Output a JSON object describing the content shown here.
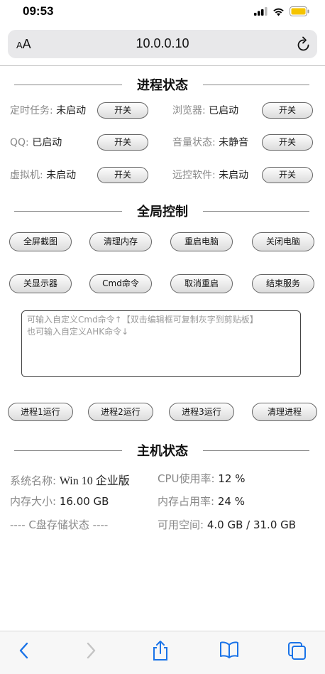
{
  "status_bar": {
    "time": "09:53"
  },
  "browser": {
    "text_size_label": "AA",
    "url": "10.0.0.10"
  },
  "process_status": {
    "title": "进程状态",
    "items": [
      {
        "label": "定时任务:",
        "value": "未启动",
        "button": "开关"
      },
      {
        "label": "浏览器:",
        "value": "已启动",
        "button": "开关"
      },
      {
        "label": "QQ:",
        "value": "已启动",
        "button": "开关"
      },
      {
        "label": "音量状态:",
        "value": "未静音",
        "button": "开关"
      },
      {
        "label": "虚拟机:",
        "value": "未启动",
        "button": "开关"
      },
      {
        "label": "远控软件:",
        "value": "未启动",
        "button": "开关"
      }
    ]
  },
  "global_control": {
    "title": "全局控制",
    "buttons_row1": [
      "全屏截图",
      "清理内存",
      "重启电脑",
      "关闭电脑"
    ],
    "buttons_row2": [
      "关显示器",
      "Cmd命令",
      "取消重启",
      "结束服务"
    ],
    "command_placeholder_line1": "可输入自定义Cmd命令↑【双击编辑框可复制灰字到剪贴板】",
    "command_placeholder_line2": "也可输入自定义AHK命令↓",
    "process_buttons": [
      "进程1运行",
      "进程2运行",
      "进程3运行",
      "清理进程"
    ]
  },
  "host_status": {
    "title": "主机状态",
    "system_name_label": "系统名称:",
    "system_name_value": "Win 10 企业版",
    "cpu_label": "CPU使用率:",
    "cpu_value": "12 %",
    "memory_size_label": "内存大小:",
    "memory_size_value": "16.00 GB",
    "memory_usage_label": "内存占用率:",
    "memory_usage_value": "24 %",
    "disk_section_label": "---- C盘存储状态 ----",
    "free_space_label": "可用空间:",
    "free_space_value": "4.0 GB / 31.0 GB"
  },
  "icons": [
    "signal-icon",
    "wifi-icon",
    "battery-icon",
    "reload-icon",
    "back-icon",
    "forward-icon",
    "share-icon",
    "bookmarks-icon",
    "tabs-icon"
  ],
  "colors": {
    "battery": "#f5c400",
    "accent": "#1a73e8"
  }
}
